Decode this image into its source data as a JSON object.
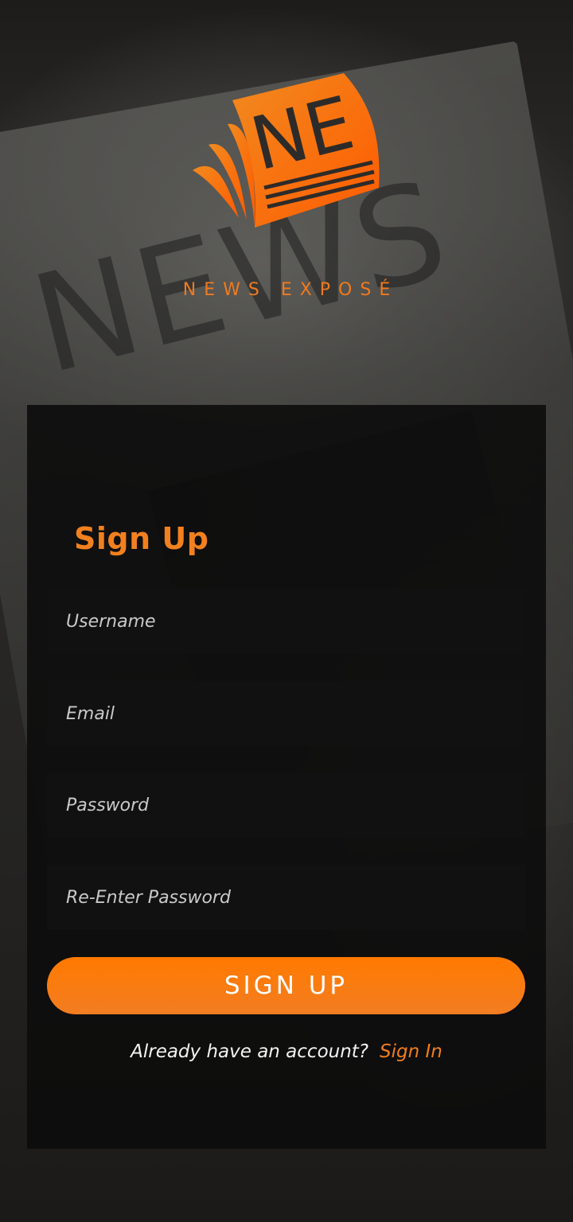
{
  "app": {
    "brand_name": "NEWS EXPOSÉ",
    "logo_initials": "NE"
  },
  "form": {
    "title": "Sign Up",
    "fields": {
      "username_placeholder": "Username",
      "email_placeholder": "Email",
      "password_placeholder": "Password",
      "confirm_password_placeholder": "Re-Enter Password"
    },
    "submit_label": "SIGN UP",
    "footer_prompt": "Already have an account?",
    "signin_link_label": "Sign In"
  },
  "colors": {
    "accent": "#f07a1e",
    "button": "#ff7a00",
    "card_background": "#0c0c0c",
    "field_background": "#111111"
  }
}
